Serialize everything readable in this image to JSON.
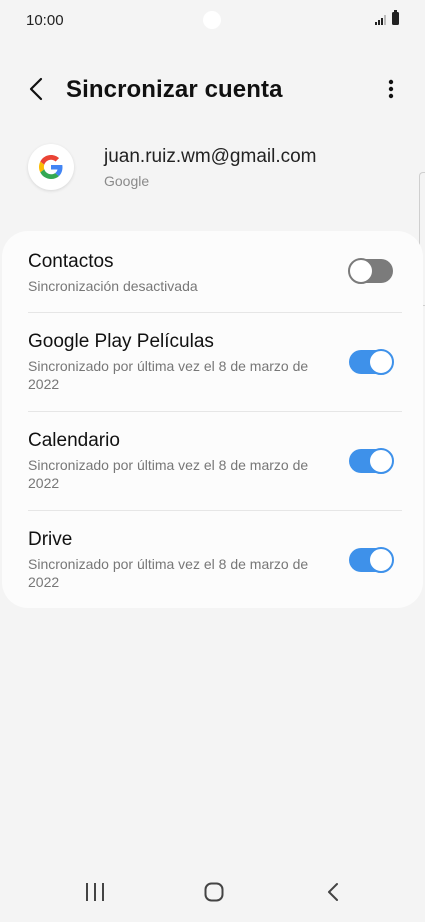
{
  "status_bar": {
    "time": "10:00"
  },
  "header": {
    "title": "Sincronizar cuenta"
  },
  "account": {
    "email": "juan.ruiz.wm@gmail.com",
    "provider": "Google"
  },
  "sync_items": [
    {
      "title": "Contactos",
      "subtitle": "Sincronización desactivada",
      "enabled": false
    },
    {
      "title": "Google Play Películas",
      "subtitle": "Sincronizado por última vez el 8 de marzo de 2022",
      "enabled": true
    },
    {
      "title": "Calendario",
      "subtitle": "Sincronizado por última vez el 8 de marzo de 2022",
      "enabled": true
    },
    {
      "title": "Drive",
      "subtitle": "Sincronizado por última vez el 8 de marzo de 2022",
      "enabled": true
    }
  ],
  "colors": {
    "toggle_on": "#3e91ea",
    "toggle_off": "#7b7b7b",
    "background": "#f4f4f4"
  },
  "icons": {
    "back": "arrow-back-icon",
    "more": "more-vert-icon",
    "account": "google-logo-icon",
    "nav_recent": "recent-apps-icon",
    "nav_home": "home-icon",
    "nav_back": "nav-back-icon"
  }
}
